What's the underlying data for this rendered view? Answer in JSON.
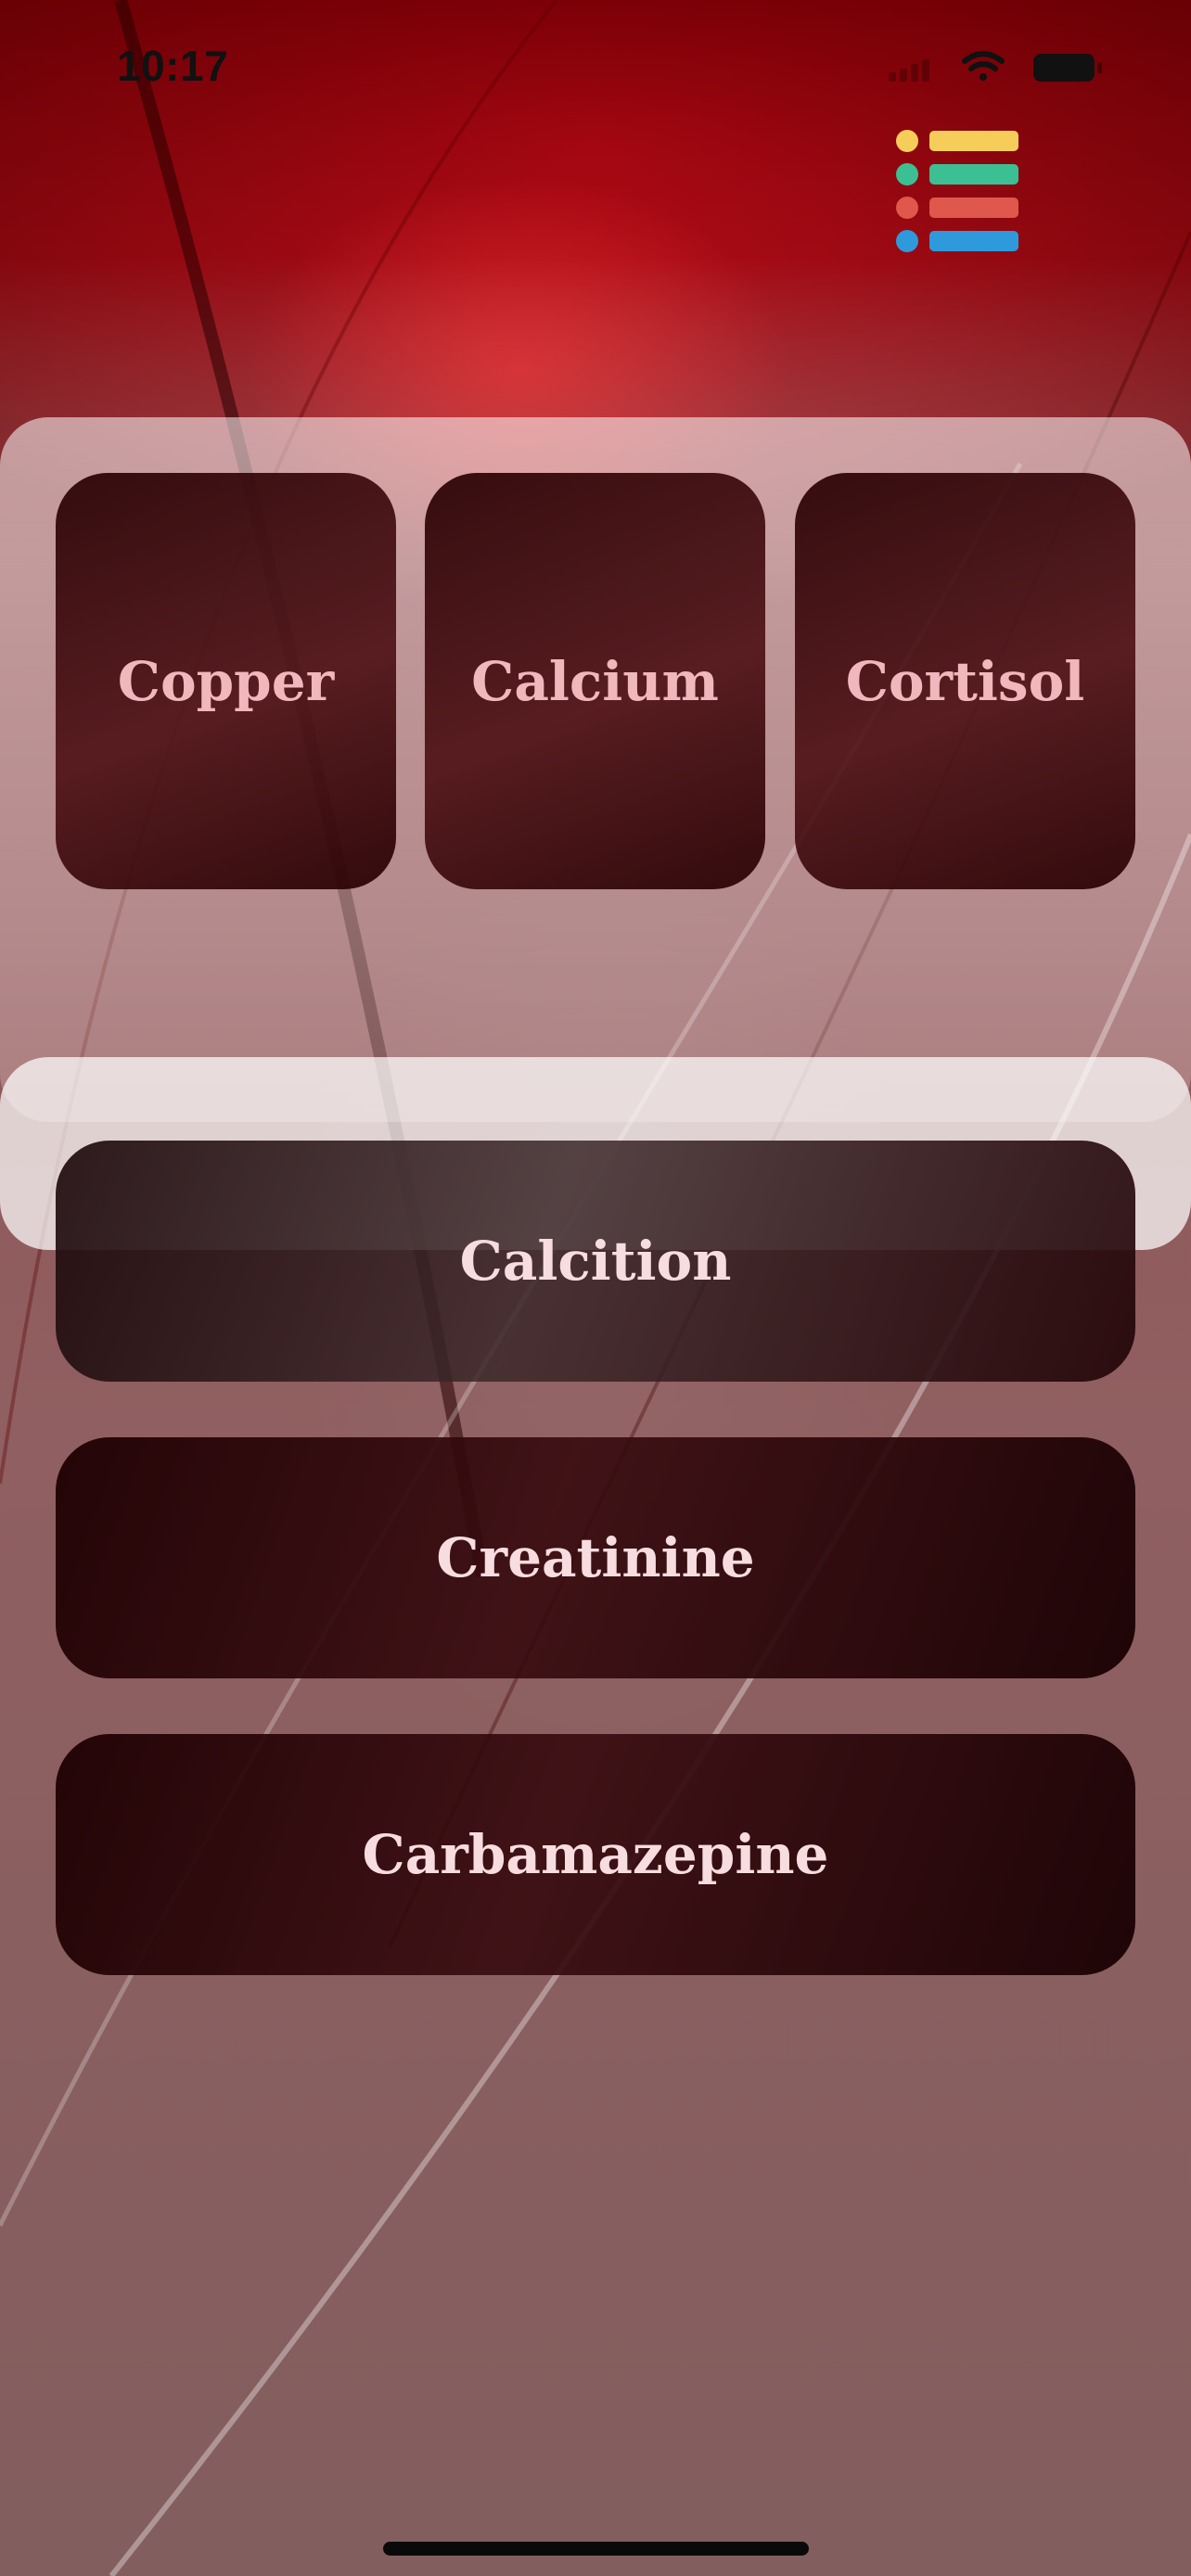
{
  "status_bar": {
    "time": "10:17",
    "icons": [
      "cellular-signal-icon",
      "wifi-icon",
      "battery-icon"
    ]
  },
  "header": {
    "menu_icon": "colored-list-menu-icon",
    "menu_colors": [
      "#F7CD5A",
      "#3DBF94",
      "#E0574C",
      "#2E9ADB"
    ]
  },
  "tiles": [
    {
      "label": "Copper"
    },
    {
      "label": "Calcium"
    },
    {
      "label": "Cortisol"
    }
  ],
  "list": [
    {
      "label": "Calcition"
    },
    {
      "label": "Creatinine"
    },
    {
      "label": "Carbamazepine"
    }
  ]
}
